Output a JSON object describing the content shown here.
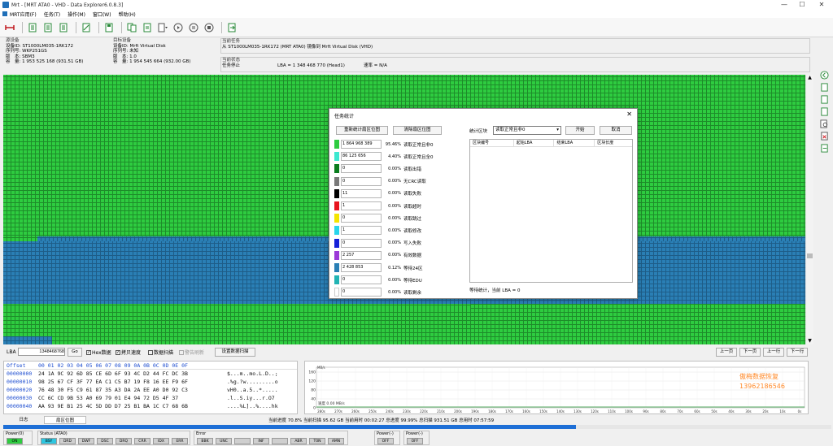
{
  "window": {
    "title": "Mrt - [MRT ATA0 - VHD - Data Explorer6.0.8.3]",
    "min": "—",
    "max": "☐",
    "close": "✕"
  },
  "menu": [
    "MRT应用(F)",
    "任务(T)",
    "操作(M)",
    "窗口(W)",
    "帮助(H)"
  ],
  "source": {
    "heading": "源设备",
    "id": "设备ID: ST1000LM035-1RK172",
    "serial": "序列号: WKP251GS",
    "version": "版　本: SBM3",
    "capacity": "容　量: 1 953 525 168 (931.51 GB)"
  },
  "target": {
    "heading": "目标设备",
    "id": "设备ID: Mrft Virtual Disk",
    "serial": "序列号: 未知",
    "version": "版　本: 1.0",
    "capacity": "容　量: 1 954 545 664 (932.00 GB)"
  },
  "task": {
    "heading": "当前任务",
    "text": "从 ST1000LM035-1RK172 (MRT ATA0) 镜像到 Mrft Virtual Disk (VHD)"
  },
  "task_status": {
    "heading": "当前状态",
    "state": "任务停止",
    "lba": "LBA = 1 348 468 770 (Head1)",
    "rate": "速率 = N/A"
  },
  "dialog": {
    "title": "任务统计",
    "close": "✕",
    "btn_redraw": "重新统计扇区位图",
    "btn_clear": "清除扇区位图",
    "block_label": "统计区块",
    "block_value": "读取正常且非0",
    "btn_start": "开始",
    "btn_cancel": "取消",
    "table_headers": [
      "区块编号",
      "起始LBA",
      "结束LBA",
      "区块长度"
    ],
    "footer": "等待统计，当前 LBA = 0",
    "stats": [
      {
        "color": "#2ecc40",
        "value": "1 864 968 389",
        "pct": "95.46%",
        "label": "读取正常且非0"
      },
      {
        "color": "#3ce8d0",
        "value": "86 125 656",
        "pct": "4.40%",
        "label": "读取正常且全0"
      },
      {
        "color": "#0a7d1e",
        "value": "0",
        "pct": "0.00%",
        "label": "读取出错"
      },
      {
        "color": "#7a7a7a",
        "value": "0",
        "pct": "0.00%",
        "label": "无CRC读取"
      },
      {
        "color": "#000000",
        "value": "11",
        "pct": "0.00%",
        "label": "读取失败"
      },
      {
        "color": "#e8141e",
        "value": "1",
        "pct": "0.00%",
        "label": "读取超时"
      },
      {
        "color": "#f4e400",
        "value": "0",
        "pct": "0.00%",
        "label": "读取跳过"
      },
      {
        "color": "#27d5ec",
        "value": "1",
        "pct": "0.00%",
        "label": "读取修改"
      },
      {
        "color": "#1420d8",
        "value": "0",
        "pct": "0.00%",
        "label": "写入失败"
      },
      {
        "color": "#9b3ad8",
        "value": "2 257",
        "pct": "0.00%",
        "label": "有效数据"
      },
      {
        "color": "#2a7fb5",
        "value": "2 428 853",
        "pct": "0.12%",
        "label": "等待24区"
      },
      {
        "color": "#22b4b4",
        "value": "0",
        "pct": "0.00%",
        "label": "等待EDU"
      },
      {
        "color": "#ffffff",
        "value": "0",
        "pct": "0.00%",
        "label": "读取剩余"
      }
    ]
  },
  "lba": {
    "label": "LBA",
    "value": "1348468768",
    "go": "Go",
    "hex": "Hex数据",
    "copy": "拷贝速度",
    "data_scan": "数据扫描",
    "warn": "警告刷新",
    "set_scan": "设置数据扫描",
    "prev_page": "上一页",
    "next_page": "下一页",
    "prev_row": "上一行",
    "next_row": "下一行"
  },
  "hex": {
    "header_offset": "Offset",
    "header_bytes": "00 01 02 03 04 05 06 07 08 09 0A 0B 0C 0D 0E 0F",
    "rows": [
      {
        "off": "00000000",
        "bytes": "24 1A 9C 92 6D 85 CE 6D 6F 93 4C D2 44 FC DC 3B",
        "asc": "$...m..mo.L.D..;"
      },
      {
        "off": "00000010",
        "bytes": "98 25 67 CF 3F 77 EA C1 C5 B7 19 F8 16 EE F9 6F",
        "asc": ".%g.?w.........o"
      },
      {
        "off": "00000020",
        "bytes": "76 48 30 F5 C9 61 87 35 A3 DA 2A EE A0 D0 92 C3",
        "asc": "vH0..a.5..*....."
      },
      {
        "off": "00000030",
        "bytes": "CC 6C CD 9B 53 A0 69 79 01 E4 94 72 D5 4F 37",
        "asc": ".l..S.iy...r.O7"
      },
      {
        "off": "00000040",
        "bytes": "AA 93 9E B1 25 4C 5D DD D7 25 B1 BA 1C C7 68 6B",
        "asc": "....%L]..%....hk"
      }
    ]
  },
  "graph": {
    "y_unit": "MB/s",
    "y_ticks": [
      "160",
      "120",
      "80",
      "40",
      "0"
    ],
    "x_ticks": [
      "280s",
      "270s",
      "260s",
      "250s",
      "240s",
      "230s",
      "220s",
      "210s",
      "200s",
      "190s",
      "180s",
      "170s",
      "160s",
      "150s",
      "140s",
      "130s",
      "120s",
      "110s",
      "100s",
      "90s",
      "80s",
      "70s",
      "60s",
      "50s",
      "40s",
      "30s",
      "20s",
      "10s",
      "0s"
    ],
    "speed_label": "速度 0.00 MB/s",
    "watermark": "傲梅数据恢复",
    "phone": "13962186546"
  },
  "tabs": [
    "日志",
    "扇区位图"
  ],
  "status": {
    "text": "当前进度 70.8%  当前扫描 95.62 GB  当前用时 00:02:27  总进度 99.99%  总扫描 931.51 GB  总用时 07:57:59",
    "progress": 0.692
  },
  "bottom": {
    "power0": {
      "label": "Power(0)",
      "items": [
        "ON"
      ]
    },
    "status": {
      "label": "Status (ATA0)",
      "items": [
        "BSY",
        "DRD",
        "DWF",
        "DSC",
        "DRQ",
        "CRR",
        "IDX",
        "ERR"
      ]
    },
    "error": {
      "label": "Error",
      "items": [
        "BBK",
        "UNC",
        "",
        "INF",
        "",
        "ABR",
        "T0N",
        "AMN"
      ]
    },
    "power1": {
      "label": "Power(-)",
      "items": [
        "OFF"
      ]
    },
    "power2": {
      "label": "Power(-)",
      "items": [
        "OFF"
      ]
    }
  }
}
